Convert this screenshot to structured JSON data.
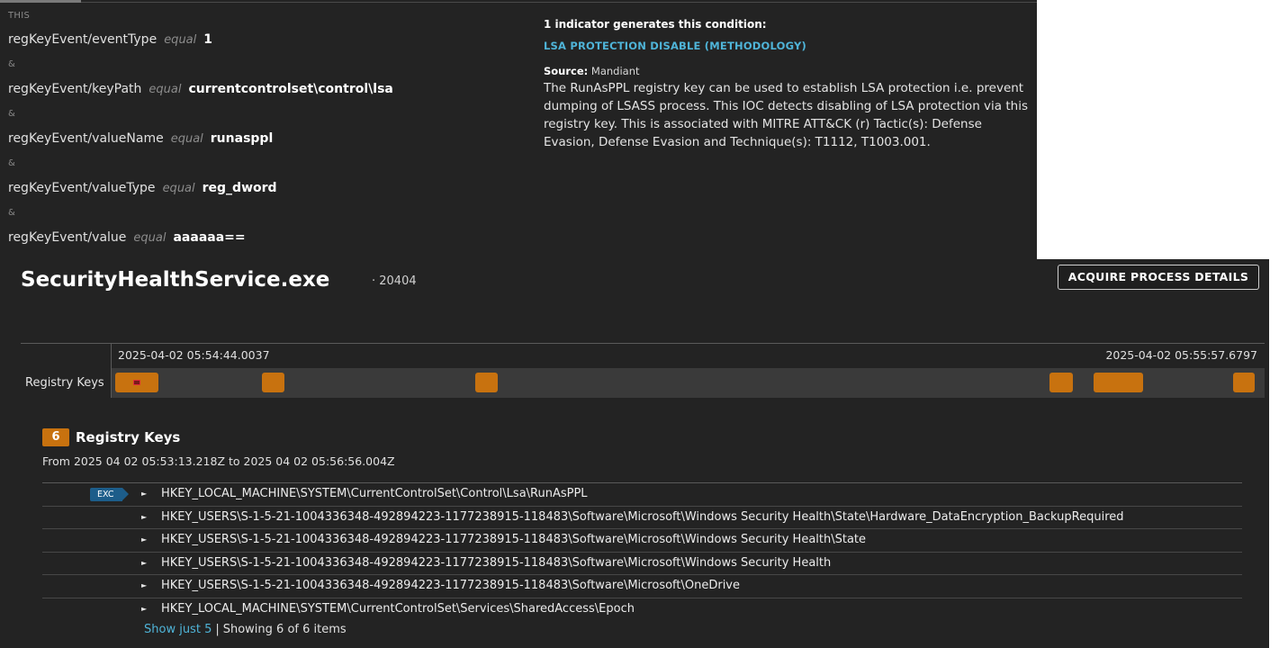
{
  "ioc": {
    "this_label": "THIS",
    "amp": "&",
    "conditions": [
      {
        "field": "regKeyEvent/eventType",
        "op": "equal",
        "value": "1"
      },
      {
        "field": "regKeyEvent/keyPath",
        "op": "equal",
        "value": "currentcontrolset\\control\\lsa"
      },
      {
        "field": "regKeyEvent/valueName",
        "op": "equal",
        "value": "runasppl"
      },
      {
        "field": "regKeyEvent/valueType",
        "op": "equal",
        "value": "reg_dword"
      },
      {
        "field": "regKeyEvent/value",
        "op": "equal",
        "value": "aaaaaa=="
      }
    ],
    "indicator": {
      "heading": "1 indicator generates this condition:",
      "name": "LSA PROTECTION DISABLE (METHODOLOGY)",
      "source_label": "Source:",
      "source_value": "Mandiant",
      "description": "The RunAsPPL registry key can be used to establish LSA protection i.e. prevent dumping of LSASS process. This IOC detects disabling of LSA protection via this registry key. This is associated with MITRE ATT&CK (r) Tactic(s): Defense Evasion, Defense Evasion and Technique(s): T1112, T1003.001."
    }
  },
  "process": {
    "name": "SecurityHealthService.exe",
    "pid": "· 20404",
    "acquire_label": "ACQUIRE PROCESS DETAILS",
    "timeline": {
      "start": "2025-04-02 05:54:44.0037",
      "end": "2025-04-02 05:55:57.6797",
      "row_label": "Registry Keys"
    },
    "registry": {
      "count": "6",
      "title": "Registry Keys",
      "range": "From 2025 04 02 05:53:13.218Z to 2025 04 02 05:56:56.004Z",
      "exc_badge": "EXC",
      "keys": [
        "HKEY_LOCAL_MACHINE\\SYSTEM\\CurrentControlSet\\Control\\Lsa\\RunAsPPL",
        "HKEY_USERS\\S-1-5-21-1004336348-492894223-1177238915-118483\\Software\\Microsoft\\Windows Security Health\\State\\Hardware_DataEncryption_BackupRequired",
        "HKEY_USERS\\S-1-5-21-1004336348-492894223-1177238915-118483\\Software\\Microsoft\\Windows Security Health\\State",
        "HKEY_USERS\\S-1-5-21-1004336348-492894223-1177238915-118483\\Software\\Microsoft\\Windows Security Health",
        "HKEY_USERS\\S-1-5-21-1004336348-492894223-1177238915-118483\\Software\\Microsoft\\OneDrive",
        "HKEY_LOCAL_MACHINE\\SYSTEM\\CurrentControlSet\\Services\\SharedAccess\\Epoch"
      ],
      "footer": {
        "show_link": "Show just 5",
        "separator": "|",
        "showing": "Showing 6 of 6 items"
      }
    }
  },
  "colors": {
    "accent_orange": "#c8720f",
    "link_blue": "#4fb4d8",
    "badge_blue": "#1d5d8a",
    "background": "#232323"
  }
}
